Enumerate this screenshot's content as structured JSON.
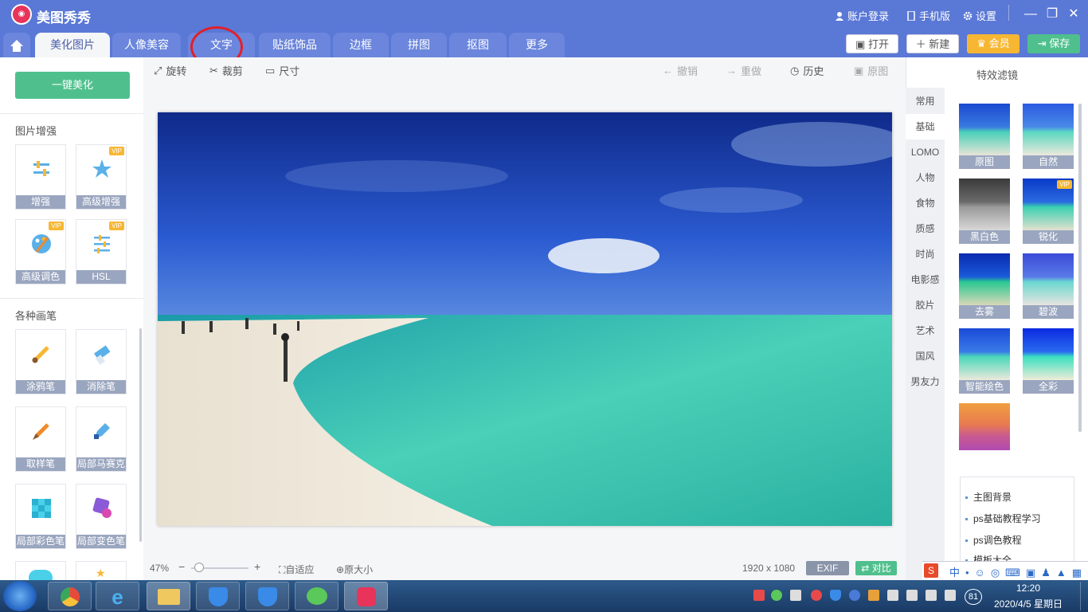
{
  "app": {
    "title": "美图秀秀"
  },
  "header": {
    "account": "账户登录",
    "mobile": "手机版",
    "settings": "设置",
    "open": "打开",
    "new": "新建",
    "vip": "会员",
    "save": "保存"
  },
  "tabs": [
    {
      "label": "美化图片",
      "active": true
    },
    {
      "label": "人像美容"
    },
    {
      "label": "文字"
    },
    {
      "label": "贴纸饰品"
    },
    {
      "label": "边框"
    },
    {
      "label": "拼图"
    },
    {
      "label": "抠图"
    },
    {
      "label": "更多"
    }
  ],
  "toolbar": {
    "rotate": "旋转",
    "crop": "裁剪",
    "size": "尺寸",
    "undo": "撤销",
    "redo": "重做",
    "history": "历史",
    "original": "原图"
  },
  "left": {
    "oneclick": "一键美化",
    "enhance_title": "图片增强",
    "enhance_tools": [
      {
        "label": "增强"
      },
      {
        "label": "高级增强",
        "vip": "VIP"
      },
      {
        "label": "高级调色",
        "vip": "VIP"
      },
      {
        "label": "HSL",
        "vip": "VIP"
      }
    ],
    "brush_title": "各种画笔",
    "brush_tools": [
      {
        "label": "涂鸦笔"
      },
      {
        "label": "消除笔"
      },
      {
        "label": "取样笔"
      },
      {
        "label": "局部马赛克"
      },
      {
        "label": "局部彩色笔"
      },
      {
        "label": "局部变色笔"
      }
    ]
  },
  "right": {
    "title": "特效滤镜",
    "categories": [
      "常用",
      "基础",
      "LOMO",
      "人物",
      "食物",
      "质感",
      "时尚",
      "电影感",
      "胶片",
      "艺术",
      "国风",
      "男友力"
    ],
    "active_category": "基础",
    "filters": [
      {
        "label": "原图"
      },
      {
        "label": "自然"
      },
      {
        "label": "黑白色"
      },
      {
        "label": "锐化",
        "vip": "VIP"
      },
      {
        "label": "去雾"
      },
      {
        "label": "碧波"
      },
      {
        "label": "智能绘色"
      },
      {
        "label": "全彩"
      }
    ],
    "links": [
      "主图背景",
      "ps基础教程学习",
      "ps调色教程",
      "模板大全"
    ]
  },
  "bottom": {
    "zoom": "47%",
    "fit": "自适应",
    "actual": "原大小",
    "dimensions": "1920 x 1080",
    "exif": "EXIF",
    "compare": "对比"
  },
  "taskbar": {
    "time": "12:20",
    "date": "2020/4/5 星期日",
    "badge": "81"
  },
  "colors": {
    "titlebar": "#5a78d6",
    "accent_green": "#4fc08d",
    "vip_gold": "#f7b733"
  }
}
